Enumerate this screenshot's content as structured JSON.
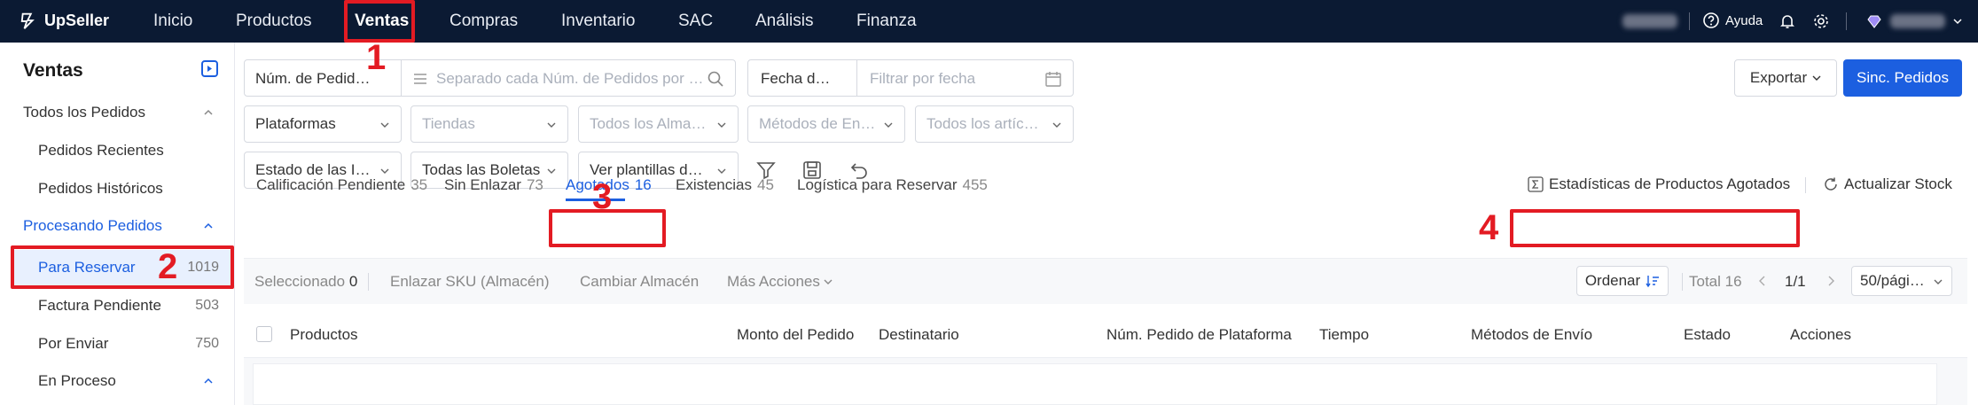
{
  "app": {
    "logo_text": "UpSeller"
  },
  "topnav": {
    "items": [
      "Inicio",
      "Productos",
      "Ventas",
      "Compras",
      "Inventario",
      "SAC",
      "Análisis",
      "Finanza"
    ],
    "active": "Ventas",
    "help_label": "Ayuda"
  },
  "annotations": [
    "1",
    "2",
    "3",
    "4"
  ],
  "sidebar": {
    "title": "Ventas",
    "groups": [
      {
        "label": "Todos los Pedidos"
      },
      {
        "label": "Procesando Pedidos"
      },
      {
        "label": "En Proceso"
      }
    ],
    "items": [
      {
        "label": "Pedidos Recientes"
      },
      {
        "label": "Pedidos Históricos"
      },
      {
        "label": "Para Reservar",
        "count": "1019"
      },
      {
        "label": "Factura Pendiente",
        "count": "503"
      },
      {
        "label": "Por Enviar",
        "count": "750"
      }
    ]
  },
  "filters": {
    "order_number_select": "Núm. de Pedid…",
    "order_search_placeholder": "Separado cada Núm. de Pedidos por …",
    "date_type_select": "Fecha d…",
    "date_placeholder": "Filtrar por fecha",
    "platforms": "Plataformas",
    "stores": "Tiendas",
    "warehouses": "Todos los Alma…",
    "shipping_methods": "Métodos de En…",
    "items_filter": "Todos los artíc…",
    "status_filter": "Estado de las I…",
    "invoices_filter": "Todas las Boletas",
    "templates_filter": "Ver plantillas d…"
  },
  "header_buttons": {
    "export": "Exportar",
    "sync": "Sinc. Pedidos"
  },
  "tabs": [
    {
      "label": "Calificación Pendiente",
      "count": "35"
    },
    {
      "label": "Sin Enlazar",
      "count": "73"
    },
    {
      "label": "Agotados",
      "count": "16"
    },
    {
      "label": "Existencias",
      "count": "45"
    },
    {
      "label": "Logística para Reservar",
      "count": "455"
    }
  ],
  "tab_actions": {
    "stats": "Estadísticas de Productos Agotados",
    "refresh": "Actualizar Stock"
  },
  "action_bar": {
    "selected_label": "Seleccionado",
    "selected_count": "0",
    "link_sku": "Enlazar SKU (Almacén)",
    "change_warehouse": "Cambiar Almacén",
    "more_actions": "Más Acciones",
    "sort": "Ordenar",
    "total": "Total 16",
    "page": "1/1",
    "per_page": "50/pági…"
  },
  "table": {
    "columns": [
      "Productos",
      "Monto del Pedido",
      "Destinatario",
      "Núm. Pedido de Plataforma",
      "Tiempo",
      "Métodos de Envío",
      "Estado",
      "Acciones"
    ]
  },
  "colors": {
    "accent": "#1c5fe0",
    "topbar": "#0b1a33",
    "annotation": "#e31b23"
  }
}
